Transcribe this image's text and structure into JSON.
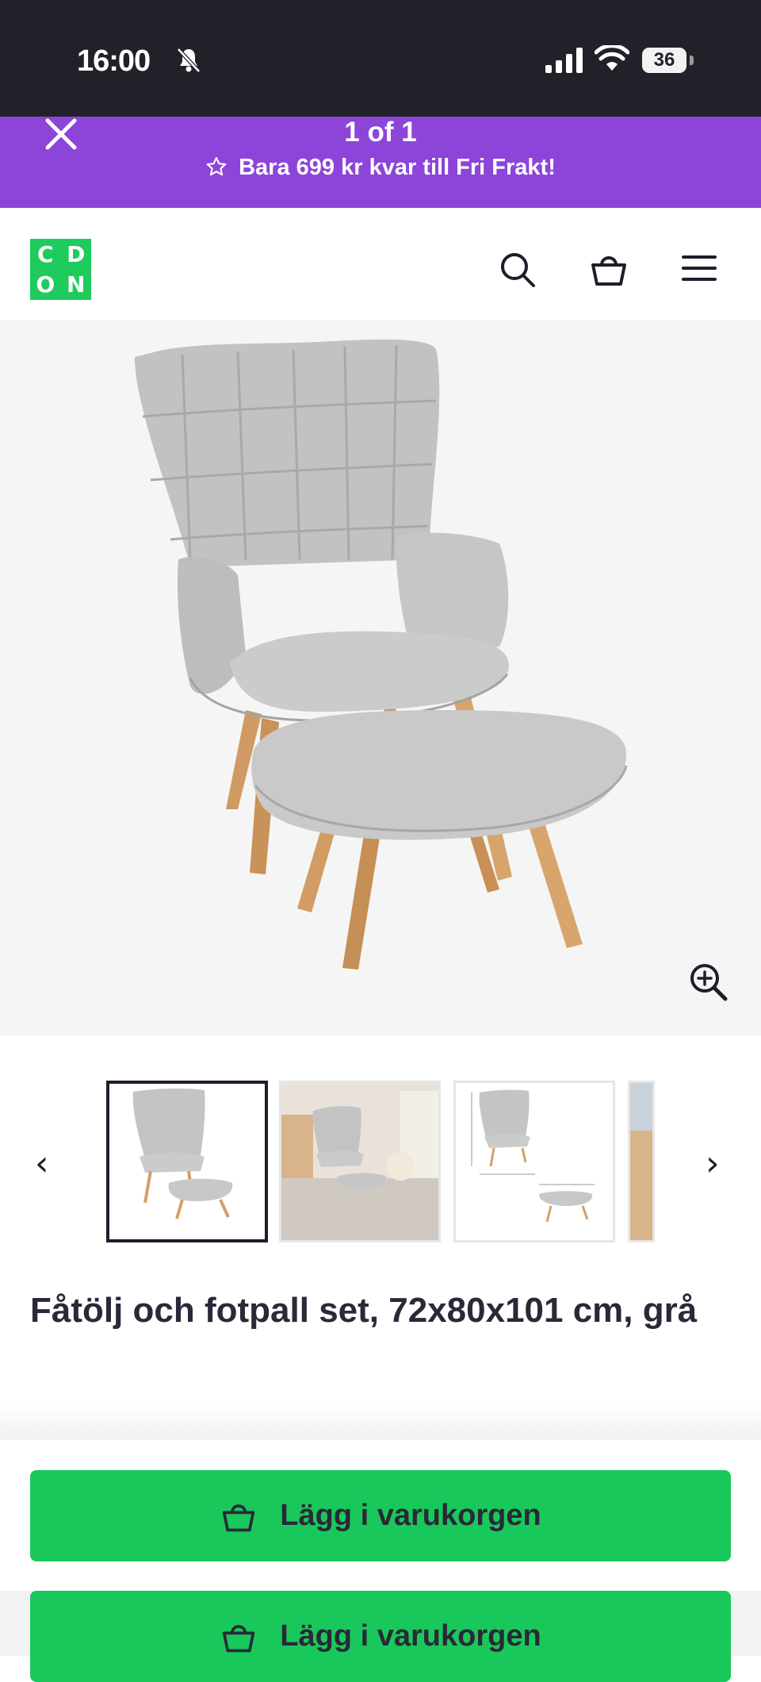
{
  "status_bar": {
    "time": "16:00",
    "battery": "36",
    "icons": [
      "bell-muted-icon",
      "signal-icon",
      "wifi-icon",
      "battery-icon"
    ]
  },
  "promo": {
    "counter": "1 of 1",
    "message": "Bara 699 kr kvar till Fri Frakt!",
    "color": "#8c44d9"
  },
  "header": {
    "logo_letters": [
      "C",
      "D",
      "O",
      "N"
    ],
    "logo_color": "#1ecb5c",
    "icons": [
      "search-icon",
      "cart-icon",
      "menu-icon"
    ]
  },
  "gallery": {
    "selected_index": 0,
    "thumbnail_count": 4,
    "prev_arrow": "‹",
    "next_arrow": "›"
  },
  "product": {
    "title": "Fåtölj och fotpall set, 72x80x101 cm, grå"
  },
  "actions": {
    "add_to_cart_label": "Lägg i varukorgen",
    "add_to_cart_label_2": "Lägg i varukorgen",
    "button_color": "#19c85b"
  }
}
